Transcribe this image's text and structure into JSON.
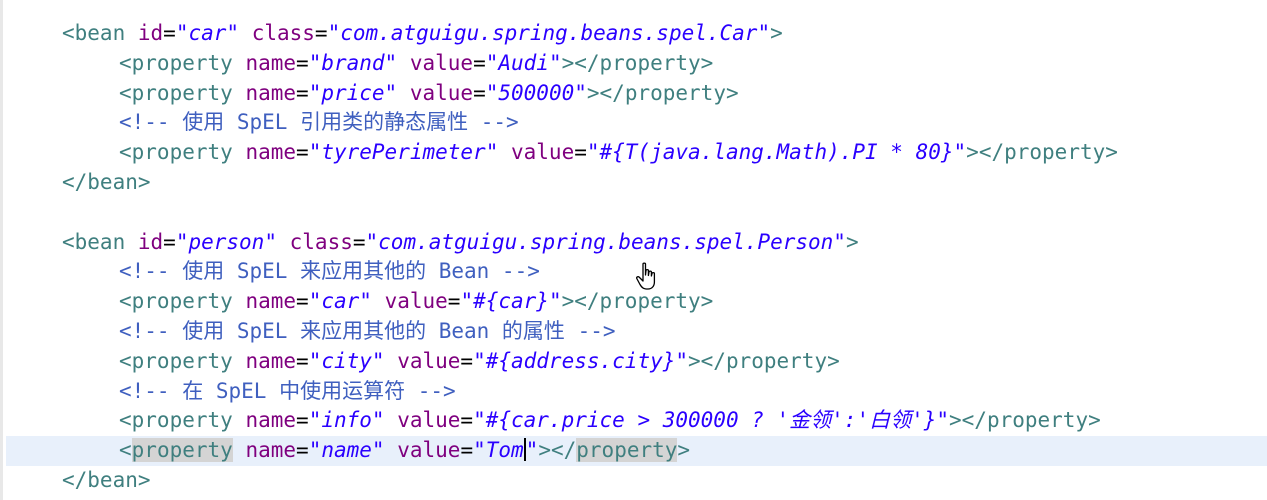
{
  "editor": {
    "lines": [
      {
        "kind": "open_tag",
        "tag": "<bean",
        "a1": "id",
        "v1": "\"car\"",
        "a2": "class",
        "v2": "\"com.atguigu.spring.beans.spel.Car\"",
        "end": ">"
      },
      {
        "kind": "property",
        "tag": "<property",
        "a1": "name",
        "v1": "\"brand\"",
        "a2": "value",
        "v2": "\"Audi\"",
        "end": "></property>"
      },
      {
        "kind": "property",
        "tag": "<property",
        "a1": "name",
        "v1": "\"price\"",
        "a2": "value",
        "v2": "\"500000\"",
        "end": "></property>"
      },
      {
        "kind": "comment",
        "text": "<!-- 使用 SpEL 引用类的静态属性 -->"
      },
      {
        "kind": "property",
        "tag": "<property",
        "a1": "name",
        "v1": "\"tyrePerimeter\"",
        "a2": "value",
        "v2": "\"#{T(java.lang.Math).PI * 80}\"",
        "end": "></property>"
      },
      {
        "kind": "close_tag",
        "text": "</bean>"
      },
      {
        "kind": "blank",
        "text": ""
      },
      {
        "kind": "open_tag",
        "tag": "<bean",
        "a1": "id",
        "v1": "\"person\"",
        "a2": "class",
        "v2": "\"com.atguigu.spring.beans.spel.Person\"",
        "end": ">"
      },
      {
        "kind": "comment",
        "text": "<!-- 使用 SpEL 来应用其他的 Bean -->"
      },
      {
        "kind": "property",
        "tag": "<property",
        "a1": "name",
        "v1": "\"car\"",
        "a2": "value",
        "v2": "\"#{car}\"",
        "end": "></property>"
      },
      {
        "kind": "comment",
        "text": "<!-- 使用 SpEL 来应用其他的 Bean 的属性 -->"
      },
      {
        "kind": "property",
        "tag": "<property",
        "a1": "name",
        "v1": "\"city\"",
        "a2": "value",
        "v2": "\"#{address.city}\"",
        "end": "></property>"
      },
      {
        "kind": "comment",
        "text": "<!-- 在 SpEL 中使用运算符 -->"
      },
      {
        "kind": "property",
        "tag": "<property",
        "a1": "name",
        "v1": "\"info\"",
        "a2": "value",
        "v2": "\"#{car.price > 300000 ? '金领':'白领'}\"",
        "end": "></property>"
      },
      {
        "kind": "current_property",
        "tag_open": "<",
        "tag_name": "property",
        "a1": "name",
        "v1": "\"name\"",
        "a2": "value",
        "v2_pre": "\"Tom",
        "v2_post": "\"",
        "end_open": "></",
        "end_name": "property",
        "end_close": ">"
      },
      {
        "kind": "close_tag",
        "text": "</bean>"
      }
    ]
  },
  "colors": {
    "tag": "#3f7f7f",
    "attribute": "#7f007f",
    "value": "#2a00ff",
    "comment": "#3f5fbf",
    "current_line": "#e8f0fb",
    "tag_highlight": "#d4d4d4"
  },
  "icons": {
    "mouse_cursor": "hand-pointer-icon"
  }
}
